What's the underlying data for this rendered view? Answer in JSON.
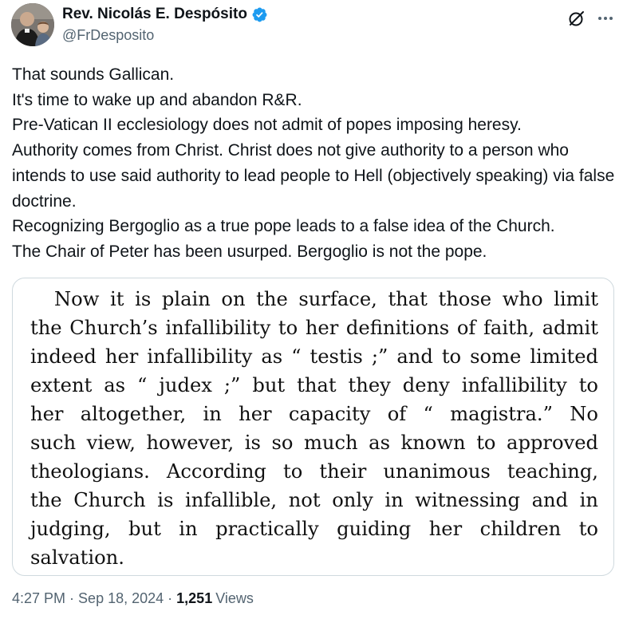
{
  "author": {
    "display_name": "Rev. Nicolás E. Despósito",
    "handle": "@FrDesposito",
    "verified": true,
    "verified_color": "#1d9bf0"
  },
  "tweet": {
    "lines": [
      "That sounds Gallican.",
      "It's time to wake up and abandon R&R.",
      "Pre-Vatican II ecclesiology does not admit of popes imposing heresy.",
      "Authority comes from Christ. Christ does not give authority to a person who intends to use said authority to lead people to Hell (objectively speaking) via false doctrine.",
      "Recognizing Bergoglio as a true pope leads to a false idea of the Church.",
      "The Chair of Peter has been usurped. Bergoglio is not the pope."
    ]
  },
  "media": {
    "scan_lines": [
      "Now it is plain on the surface, that those who limit",
      "the Church’s infallibility to her definitions of faith, admit",
      "indeed her infallibility as “ testis ;” and to some limited",
      "extent as “ judex ;” but that they deny infallibility to",
      "her altogether, in her capacity of “ magistra.” No",
      "such view, however, is so much as known to approved",
      "theologians. According to their unanimous teaching,",
      "the Church is infallible, not only in witnessing and in",
      "judging, but in practically guiding her children to",
      "salvation."
    ]
  },
  "meta": {
    "time": "4:27 PM",
    "separator": "·",
    "date": "Sep 18, 2024",
    "views_count": "1,251",
    "views_label": "Views"
  },
  "icons": {
    "grok": "grok-icon",
    "more": "more-icon",
    "verified": "verified-badge-icon"
  }
}
